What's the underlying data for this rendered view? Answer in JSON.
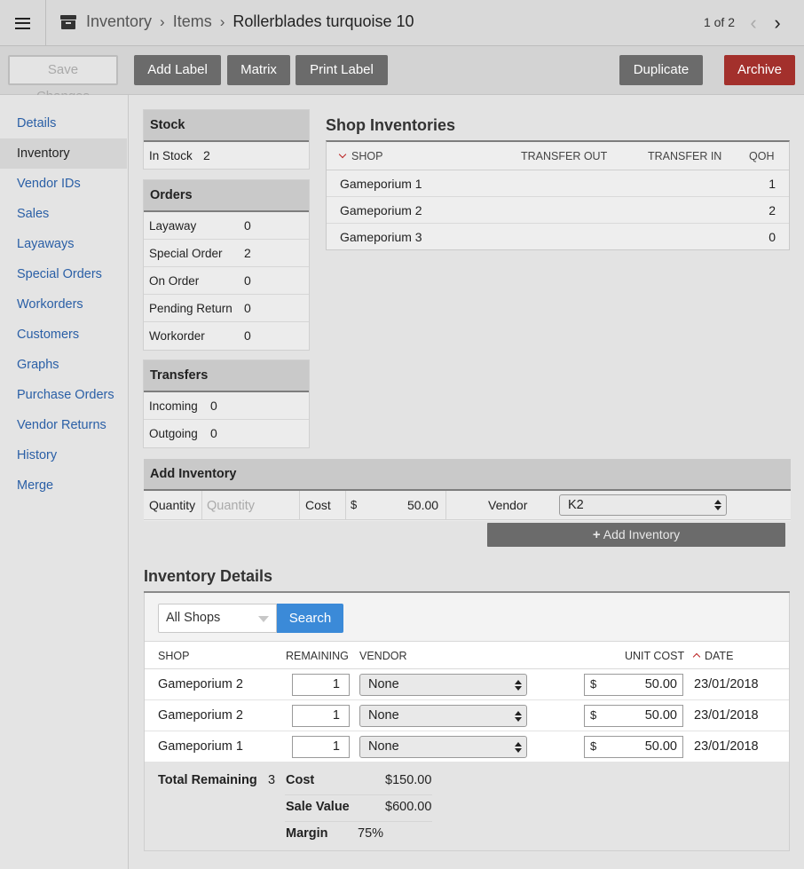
{
  "breadcrumb": {
    "root": "Inventory",
    "section": "Items",
    "current": "Rollerblades turquoise 10"
  },
  "pager": {
    "text": "1 of 2"
  },
  "toolbar": {
    "save_changes": "Save Changes",
    "add_label": "Add Label",
    "matrix": "Matrix",
    "print_label": "Print Label",
    "duplicate": "Duplicate",
    "archive": "Archive"
  },
  "sidebar": {
    "items": [
      {
        "label": "Details"
      },
      {
        "label": "Inventory"
      },
      {
        "label": "Vendor IDs"
      },
      {
        "label": "Sales"
      },
      {
        "label": "Layaways"
      },
      {
        "label": "Special Orders"
      },
      {
        "label": "Workorders"
      },
      {
        "label": "Customers"
      },
      {
        "label": "Graphs"
      },
      {
        "label": "Purchase Orders"
      },
      {
        "label": "Vendor Returns"
      },
      {
        "label": "History"
      },
      {
        "label": "Merge"
      }
    ]
  },
  "stock": {
    "title": "Stock",
    "in_stock_label": "In Stock",
    "in_stock_value": "2"
  },
  "orders": {
    "title": "Orders",
    "rows": [
      {
        "label": "Layaway",
        "value": "0"
      },
      {
        "label": "Special Order",
        "value": "2"
      },
      {
        "label": "On Order",
        "value": "0"
      },
      {
        "label": "Pending Return",
        "value": "0"
      },
      {
        "label": "Workorder",
        "value": "0"
      }
    ]
  },
  "transfers": {
    "title": "Transfers",
    "rows": [
      {
        "label": "Incoming",
        "value": "0"
      },
      {
        "label": "Outgoing",
        "value": "0"
      }
    ]
  },
  "shop_inventories": {
    "title": "Shop Inventories",
    "headers": {
      "shop": "SHOP",
      "transfer_out": "TRANSFER OUT",
      "transfer_in": "TRANSFER IN",
      "qoh": "QOH"
    },
    "rows": [
      {
        "shop": "Gameporium 1",
        "qoh": "1"
      },
      {
        "shop": "Gameporium 2",
        "qoh": "2"
      },
      {
        "shop": "Gameporium 3",
        "qoh": "0"
      }
    ]
  },
  "add_inventory": {
    "title": "Add Inventory",
    "quantity_label": "Quantity",
    "quantity_placeholder": "Quantity",
    "cost_label": "Cost",
    "currency": "$",
    "cost_value": "50.00",
    "vendor_label": "Vendor",
    "vendor_value": "K2",
    "button_label": "Add Inventory"
  },
  "inventory_details": {
    "title": "Inventory Details",
    "shop_filter": "All Shops",
    "search_label": "Search",
    "headers": {
      "shop": "SHOP",
      "remaining": "REMAINING",
      "vendor": "VENDOR",
      "unit_cost": "UNIT COST",
      "date": "DATE"
    },
    "rows": [
      {
        "shop": "Gameporium 2",
        "remaining": "1",
        "vendor": "None",
        "currency": "$",
        "unit_cost": "50.00",
        "date": "23/01/2018"
      },
      {
        "shop": "Gameporium 2",
        "remaining": "1",
        "vendor": "None",
        "currency": "$",
        "unit_cost": "50.00",
        "date": "23/01/2018"
      },
      {
        "shop": "Gameporium 1",
        "remaining": "1",
        "vendor": "None",
        "currency": "$",
        "unit_cost": "50.00",
        "date": "23/01/2018"
      }
    ],
    "summary": {
      "total_remaining_label": "Total Remaining",
      "total_remaining_value": "3",
      "cost_label": "Cost",
      "cost_value": "$150.00",
      "sale_value_label": "Sale Value",
      "sale_value_value": "$600.00",
      "margin_label": "Margin",
      "margin_value": "75%"
    }
  }
}
